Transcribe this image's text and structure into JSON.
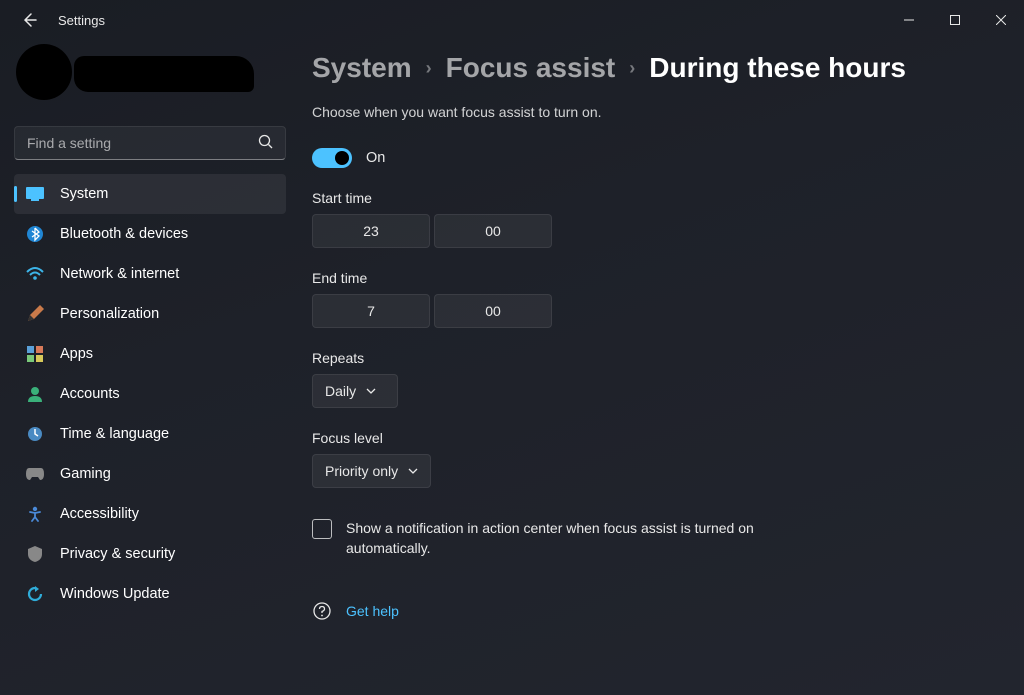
{
  "window": {
    "title": "Settings"
  },
  "search": {
    "placeholder": "Find a setting"
  },
  "sidebar": {
    "items": [
      {
        "label": "System",
        "active": true
      },
      {
        "label": "Bluetooth & devices"
      },
      {
        "label": "Network & internet"
      },
      {
        "label": "Personalization"
      },
      {
        "label": "Apps"
      },
      {
        "label": "Accounts"
      },
      {
        "label": "Time & language"
      },
      {
        "label": "Gaming"
      },
      {
        "label": "Accessibility"
      },
      {
        "label": "Privacy & security"
      },
      {
        "label": "Windows Update"
      }
    ]
  },
  "breadcrumb": {
    "level1": "System",
    "level2": "Focus assist",
    "level3": "During these hours"
  },
  "page": {
    "subtitle": "Choose when you want focus assist to turn on.",
    "toggle_label": "On",
    "start_label": "Start time",
    "start_hour": "23",
    "start_minute": "00",
    "end_label": "End time",
    "end_hour": "7",
    "end_minute": "00",
    "repeats_label": "Repeats",
    "repeats_value": "Daily",
    "focus_label": "Focus level",
    "focus_value": "Priority only",
    "checkbox_text": "Show a notification in action center when focus assist is turned on automatically.",
    "help_link": "Get help"
  }
}
